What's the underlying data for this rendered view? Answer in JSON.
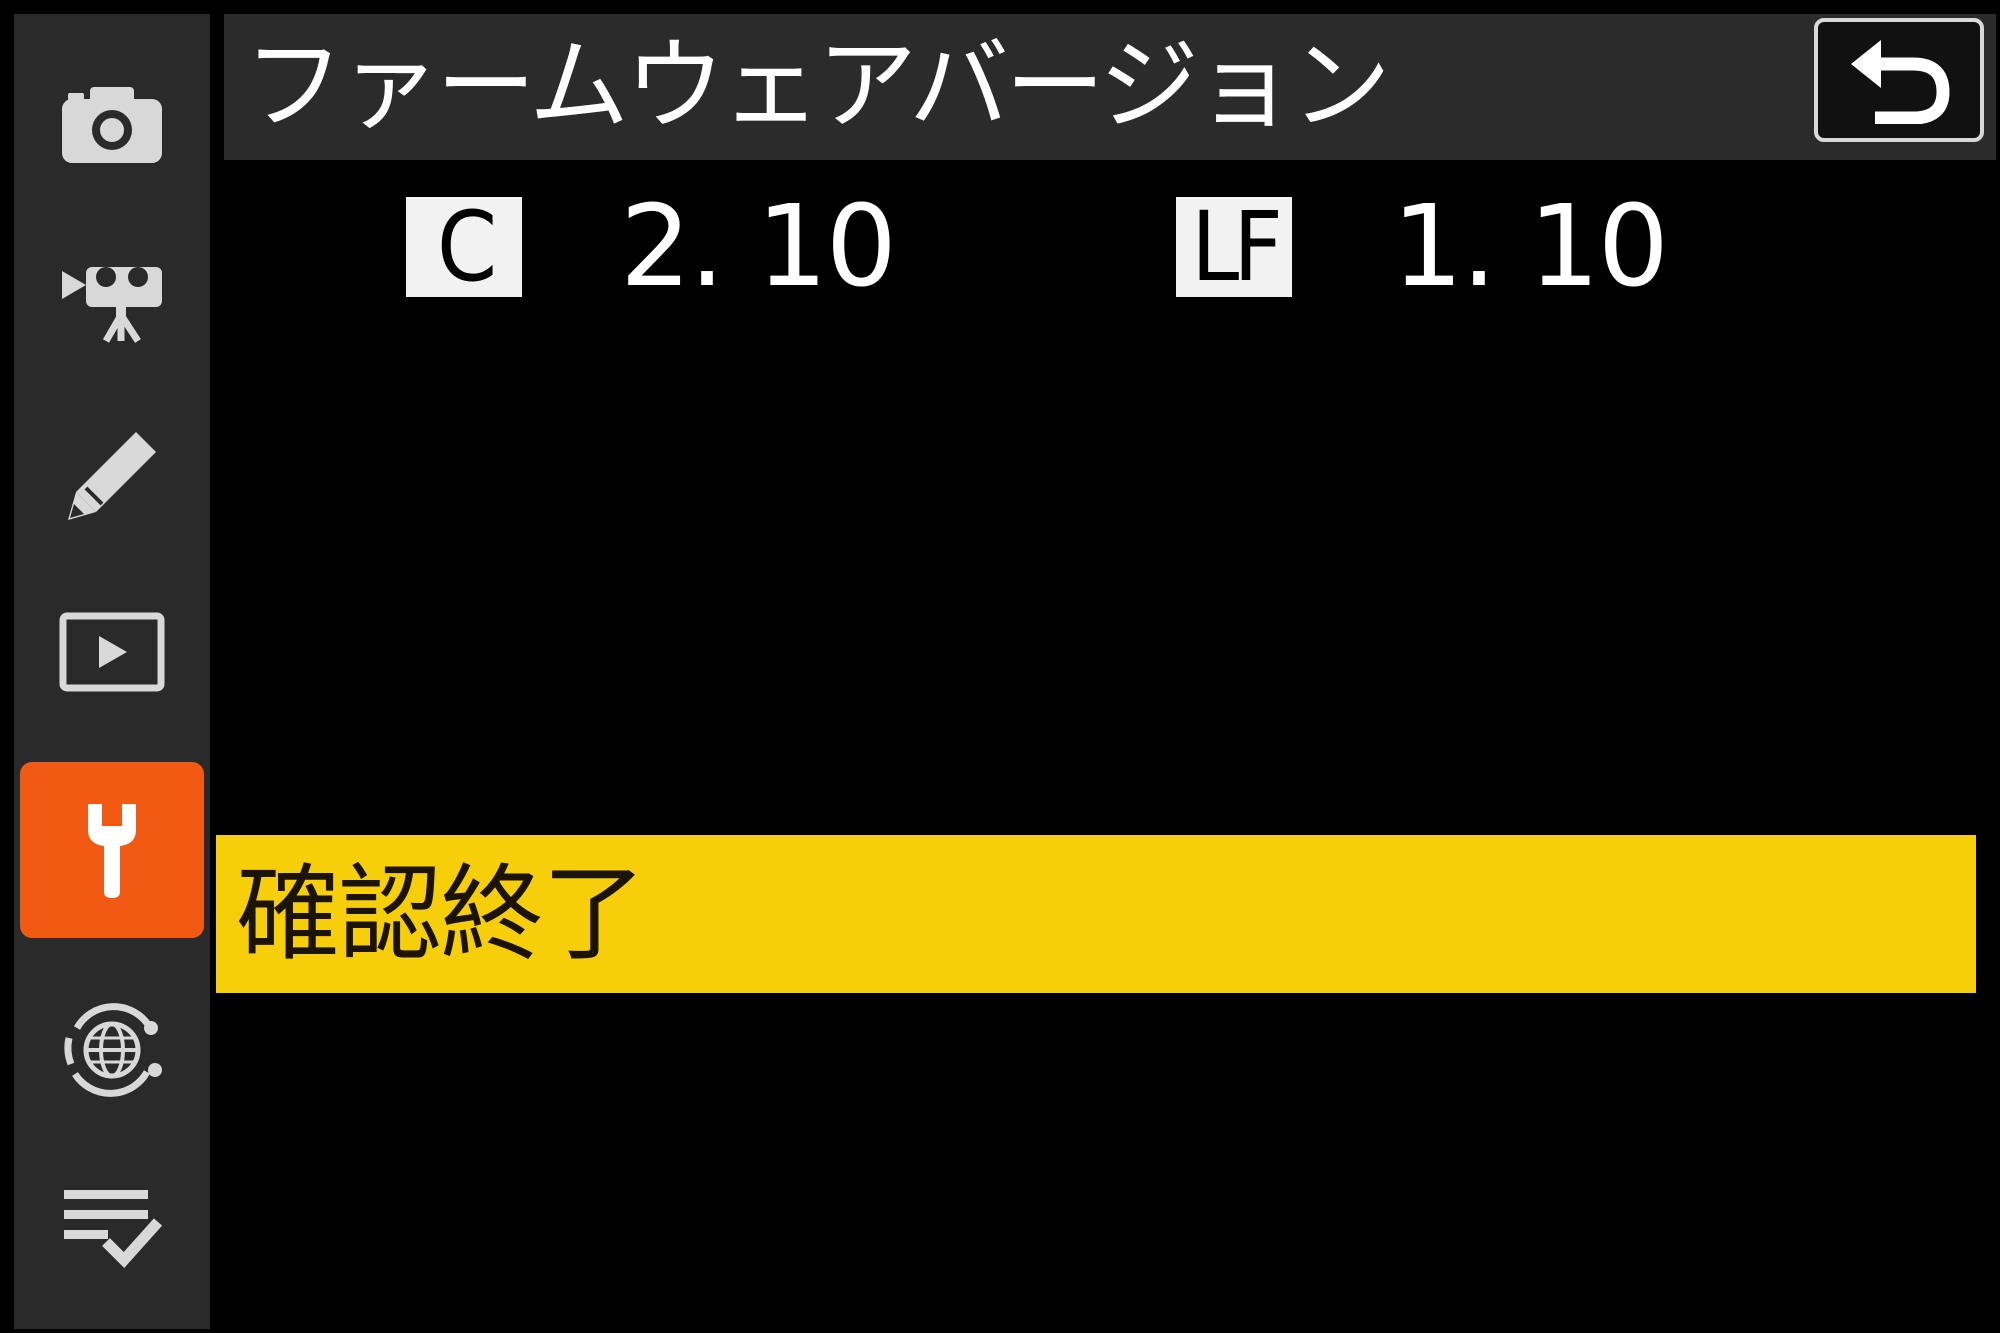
{
  "header": {
    "title": "ファームウェアバージョン"
  },
  "sidebar": {
    "tabs": [
      {
        "name": "photo-shooting-menu",
        "icon": "camera-icon",
        "active": false
      },
      {
        "name": "movie-shooting-menu",
        "icon": "movie-camera-icon",
        "active": false
      },
      {
        "name": "custom-settings-menu",
        "icon": "pencil-icon",
        "active": false
      },
      {
        "name": "playback-menu",
        "icon": "play-icon",
        "active": false
      },
      {
        "name": "setup-menu",
        "icon": "wrench-icon",
        "active": true
      },
      {
        "name": "network-menu",
        "icon": "network-globe-icon",
        "active": false
      },
      {
        "name": "my-menu",
        "icon": "checklist-icon",
        "active": false
      }
    ]
  },
  "firmware": [
    {
      "badge": "C",
      "version": "2. 10"
    },
    {
      "badge": "LF",
      "version": "1. 10"
    }
  ],
  "option": {
    "label": "確認終了"
  },
  "colors": {
    "background": "#000000",
    "panel": "#2a2a2a",
    "active_tab": "#f25a13",
    "highlight": "#f6cf0a",
    "text": "#ffffff"
  }
}
